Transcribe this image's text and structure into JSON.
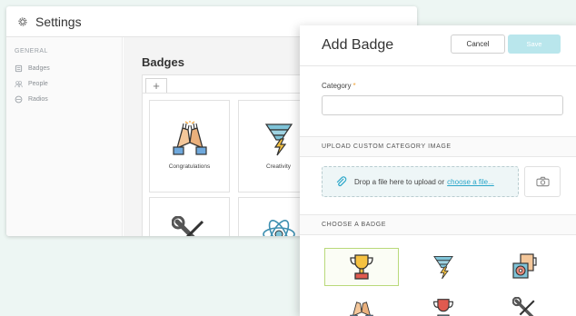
{
  "settings": {
    "title": "Settings",
    "sidebar": {
      "group": "GENERAL",
      "items": [
        {
          "label": "Badges",
          "icon": "badge-icon"
        },
        {
          "label": "People",
          "icon": "people-icon"
        },
        {
          "label": "Radios",
          "icon": "radio-icon"
        }
      ]
    },
    "page_title": "Badges",
    "add_tab_label": "+",
    "cards": [
      {
        "label": "Congratulations",
        "icon": "high-five-icon"
      },
      {
        "label": "Creativity",
        "icon": "tornado-lightning-icon"
      },
      {
        "label": "",
        "icon": "wrench-screwdriver-icon"
      },
      {
        "label": "",
        "icon": "atom-icon"
      }
    ]
  },
  "modal": {
    "title": "Add Badge",
    "cancel_label": "Cancel",
    "save_label": "Save",
    "category_label": "Category",
    "required_mark": "*",
    "upload_section": "UPLOAD CUSTOM CATEGORY IMAGE",
    "drop_text": "Drop a file here to upload or",
    "drop_link": "choose a file...",
    "choose_section": "CHOOSE A BADGE",
    "badges": [
      {
        "icon": "trophy-icon",
        "selected": true
      },
      {
        "icon": "tornado-lightning-icon",
        "selected": false
      },
      {
        "icon": "coffee-donut-icon",
        "selected": false
      },
      {
        "icon": "high-five-icon",
        "selected": false
      },
      {
        "icon": "trophy-icon",
        "selected": false
      },
      {
        "icon": "wrench-screwdriver-icon",
        "selected": false
      }
    ]
  },
  "colors": {
    "accent": "#29a6c9",
    "save_disabled": "#b9e6ec",
    "selected_border": "#b9d97a",
    "required": "#f0a43a",
    "background": "#edf6f3"
  }
}
